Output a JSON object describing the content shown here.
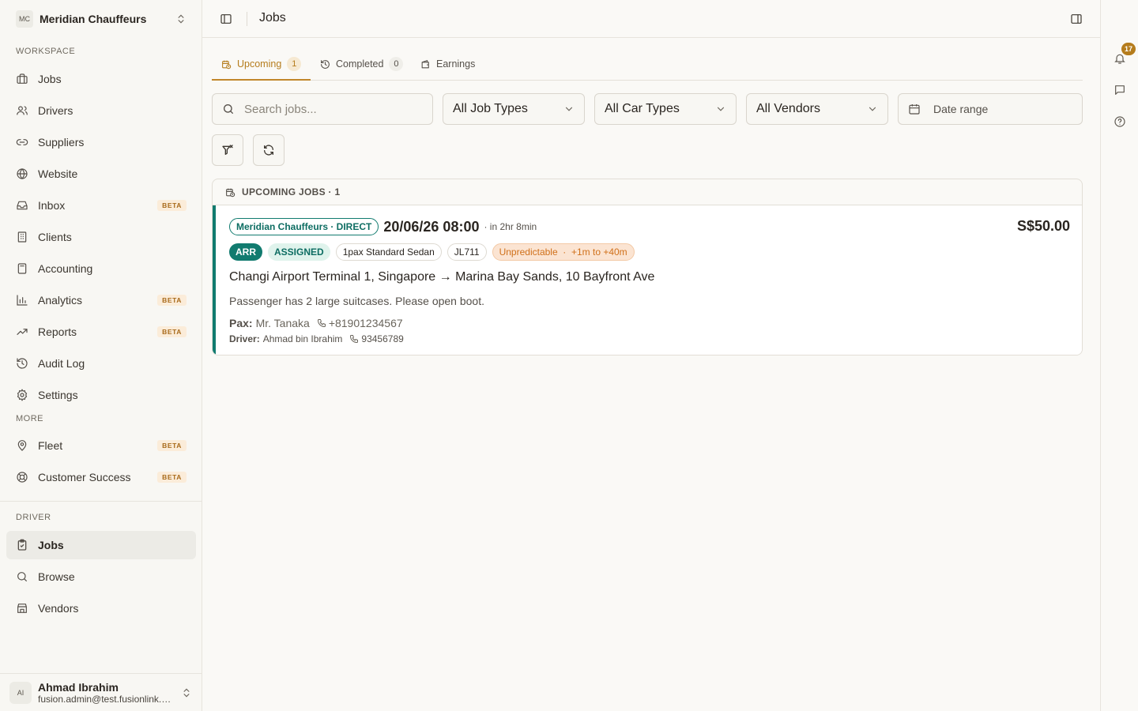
{
  "org": {
    "initials": "MC",
    "name": "Meridian Chauffeurs"
  },
  "sidebar": {
    "workspace_label": "WORKSPACE",
    "workspace": [
      {
        "label": "Jobs",
        "icon": "briefcase-icon"
      },
      {
        "label": "Drivers",
        "icon": "users-icon"
      },
      {
        "label": "Suppliers",
        "icon": "link-icon"
      },
      {
        "label": "Website",
        "icon": "globe-icon"
      },
      {
        "label": "Inbox",
        "icon": "inbox-icon",
        "badge": "BETA"
      },
      {
        "label": "Clients",
        "icon": "building-icon"
      },
      {
        "label": "Accounting",
        "icon": "calculator-icon"
      },
      {
        "label": "Analytics",
        "icon": "bar-chart-icon",
        "badge": "BETA"
      },
      {
        "label": "Reports",
        "icon": "trending-up-icon",
        "badge": "BETA"
      },
      {
        "label": "Audit Log",
        "icon": "history-icon"
      },
      {
        "label": "Settings",
        "icon": "gear-icon"
      }
    ],
    "more_label": "MORE",
    "more": [
      {
        "label": "Fleet",
        "icon": "map-pin-icon",
        "badge": "BETA"
      },
      {
        "label": "Customer Success",
        "icon": "lifebuoy-icon",
        "badge": "BETA"
      }
    ],
    "driver_label": "DRIVER",
    "driver": [
      {
        "label": "Jobs",
        "icon": "clipboard-icon",
        "active": true
      },
      {
        "label": "Browse",
        "icon": "search-icon"
      },
      {
        "label": "Vendors",
        "icon": "store-icon"
      }
    ]
  },
  "user": {
    "initials": "AI",
    "name": "Ahmad Ibrahim",
    "email": "fusion.admin@test.fusionlink.a..."
  },
  "topbar": {
    "title": "Jobs"
  },
  "rail": {
    "notifications_count": "17"
  },
  "tabs": [
    {
      "label": "Upcoming",
      "count": "1",
      "active": true
    },
    {
      "label": "Completed",
      "count": "0"
    },
    {
      "label": "Earnings"
    }
  ],
  "filters": {
    "search_placeholder": "Search jobs...",
    "job_types": "All Job Types",
    "car_types": "All Car Types",
    "vendors": "All Vendors",
    "date_range": "Date range"
  },
  "panel": {
    "title": "UPCOMING JOBS · 1"
  },
  "job": {
    "vendor": "Meridian Chauffeurs · DIRECT",
    "datetime": "20/06/26 08:00",
    "relative": "· in 2hr 8min",
    "price": "S$50.00",
    "type": "ARR",
    "status": "ASSIGNED",
    "car": "1pax Standard Sedan",
    "flight": "JL711",
    "eta": "Unpredictable  ·  +1m to +40m",
    "route": "Changi Airport Terminal 1, Singapore → Marina Bay Sands, 10 Bayfront Ave",
    "note": "Passenger has 2 large suitcases. Please open boot.",
    "pax_label": "Pax:",
    "pax_name": "Mr. Tanaka",
    "pax_phone": "+81901234567",
    "driver_label": "Driver:",
    "driver_name": "Ahmad bin Ibrahim",
    "driver_phone": "93456789"
  },
  "colors": {
    "accent": "#b57c1c",
    "teal": "#117b6f",
    "warn": "#d0701a"
  }
}
